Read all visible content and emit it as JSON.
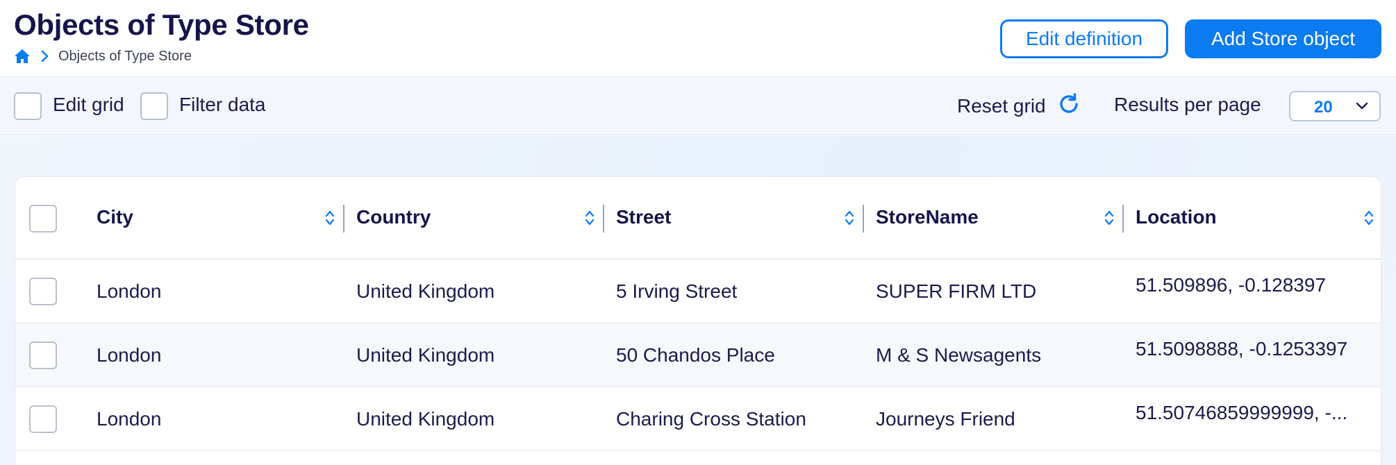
{
  "header": {
    "title": "Objects of Type Store",
    "breadcrumb": {
      "home_icon": "home-icon",
      "separator_icon": "chevron-right-icon",
      "current": "Objects of Type Store"
    },
    "edit_definition_label": "Edit definition",
    "add_object_label": "Add Store object"
  },
  "toolbar": {
    "edit_grid_label": "Edit grid",
    "filter_data_label": "Filter data",
    "reset_grid_label": "Reset grid",
    "reset_icon": "refresh-icon",
    "results_per_page_label": "Results per page",
    "results_per_page_value": "20"
  },
  "table": {
    "columns": [
      "City",
      "Country",
      "Street",
      "StoreName",
      "Location"
    ],
    "rows": [
      {
        "city": "London",
        "country": "United Kingdom",
        "street": "5 Irving Street",
        "store_name": "SUPER FIRM LTD",
        "location": "51.509896, -0.128397"
      },
      {
        "city": "London",
        "country": "United Kingdom",
        "street": "50 Chandos Place",
        "store_name": "M & S Newsagents",
        "location": "51.5098888, -0.1253397"
      },
      {
        "city": "London",
        "country": "United Kingdom",
        "street": "Charing Cross Station",
        "store_name": "Journeys Friend",
        "location": "51.50746859999999, -..."
      }
    ]
  },
  "colors": {
    "accent": "#0a7bf0",
    "title": "#16144a",
    "toolbar_bg": "#f3f7fd"
  }
}
